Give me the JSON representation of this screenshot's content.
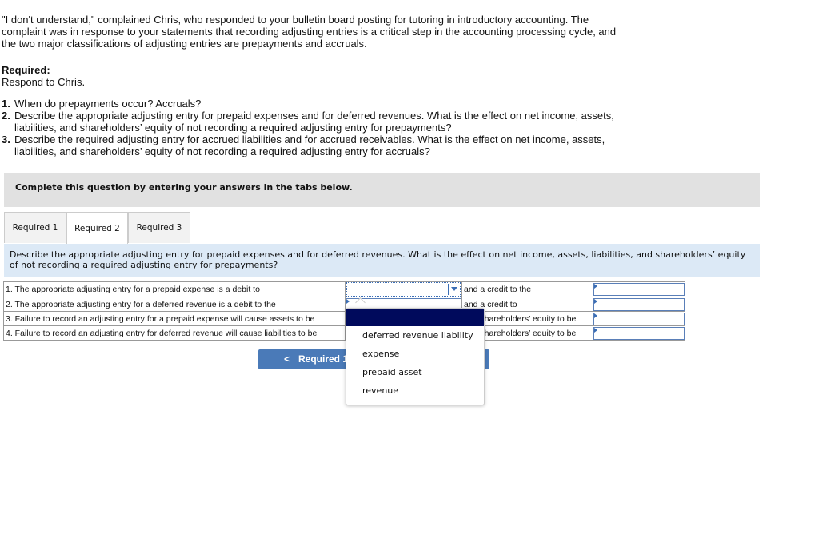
{
  "intro": "\"I don't understand,\" complained Chris, who responded to your bulletin board posting for tutoring in introductory accounting. The complaint was in response to your statements that recording adjusting entries is a critical step in the accounting processing cycle, and the two major classifications of adjusting entries are prepayments and accruals.",
  "required_label": "Required:",
  "required_text": "Respond to Chris.",
  "questions": [
    {
      "num": "1.",
      "text": "When do prepayments occur? Accruals?"
    },
    {
      "num": "2.",
      "text": "Describe the appropriate adjusting entry for prepaid expenses and for deferred revenues. What is the effect on net income, assets, liabilities, and shareholders’ equity of not recording a required adjusting entry for prepayments?"
    },
    {
      "num": "3.",
      "text": "Describe the required adjusting entry for accrued liabilities and for accrued receivables. What is the effect on net income, assets, liabilities, and shareholders’ equity of not recording a required adjusting entry for accruals?"
    }
  ],
  "instruction": "Complete this question by entering your answers in the tabs below.",
  "tabs": [
    {
      "label": "Required 1"
    },
    {
      "label": "Required 2",
      "active": true
    },
    {
      "label": "Required 3"
    }
  ],
  "tab_prompt": "Describe the appropriate adjusting entry for prepaid expenses and for deferred revenues. What is the effect on net income, assets, liabilities, and shareholders’ equity of not recording a required adjusting entry for prepayments?",
  "rows": [
    {
      "left": "1. The appropriate adjusting entry for a prepaid expense is a debit to",
      "select": "",
      "middle": "and a credit to the",
      "input": ""
    },
    {
      "left": "2. The appropriate adjusting entry for a deferred revenue is a debit to the",
      "select": "",
      "middle": "and a credit to",
      "input": ""
    },
    {
      "left": "3. Failure to record an adjusting entry for a prepaid expense will cause assets to be",
      "select": "",
      "middle": "and shareholders’ equity to be",
      "input": ""
    },
    {
      "left": "4. Failure to record an adjusting entry for deferred revenue will cause liabilities to be",
      "select": "",
      "middle": "and shareholders’ equity to be",
      "input": ""
    }
  ],
  "nav_button": {
    "label": "Required 1",
    "icon": "chevron-left-icon",
    "glyph": "<"
  },
  "dropdown": {
    "options": [
      "",
      "deferred revenue liability",
      "expense",
      "prepaid asset",
      "revenue"
    ],
    "highlighted_index": 0
  },
  "colors": {
    "button": "#4a7ab8",
    "highlight": "#000a5c",
    "prompt_bg": "#dce9f6",
    "instruction_bg": "#e1e1e1"
  }
}
